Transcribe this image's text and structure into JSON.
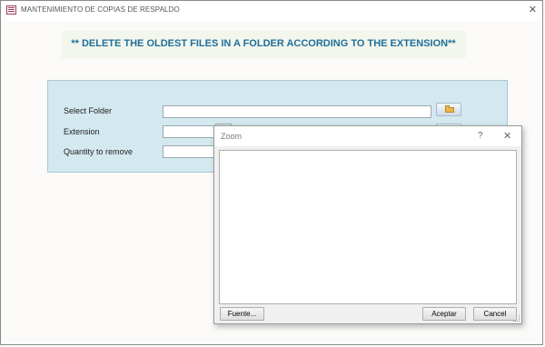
{
  "window": {
    "title": "MANTENIMIENTO DE COPIAS DE RESPALDO"
  },
  "banner": {
    "text": "** DELETE THE OLDEST FILES IN A FOLDER ACCORDING TO THE EXTENSION**"
  },
  "form": {
    "select_folder_label": "Select Folder",
    "extension_label": "Extension",
    "quantity_label": "Quantity to remove",
    "select_folder_value": "",
    "extension_value": "",
    "quantity_value": ""
  },
  "zoom_dialog": {
    "title": "Zoom",
    "help_glyph": "?",
    "close_glyph": "✕",
    "text_value": "",
    "fuente_label": "Fuente...",
    "aceptar_label": "Aceptar",
    "cancel_label": "Cancel"
  },
  "icons": [
    "app-form-icon",
    "close-icon",
    "folder-icon",
    "help-icon"
  ],
  "colors": {
    "banner_text": "#1f6f9a",
    "panel_bg": "#d3e8ef",
    "banner_bg": "#f3f6ec"
  }
}
